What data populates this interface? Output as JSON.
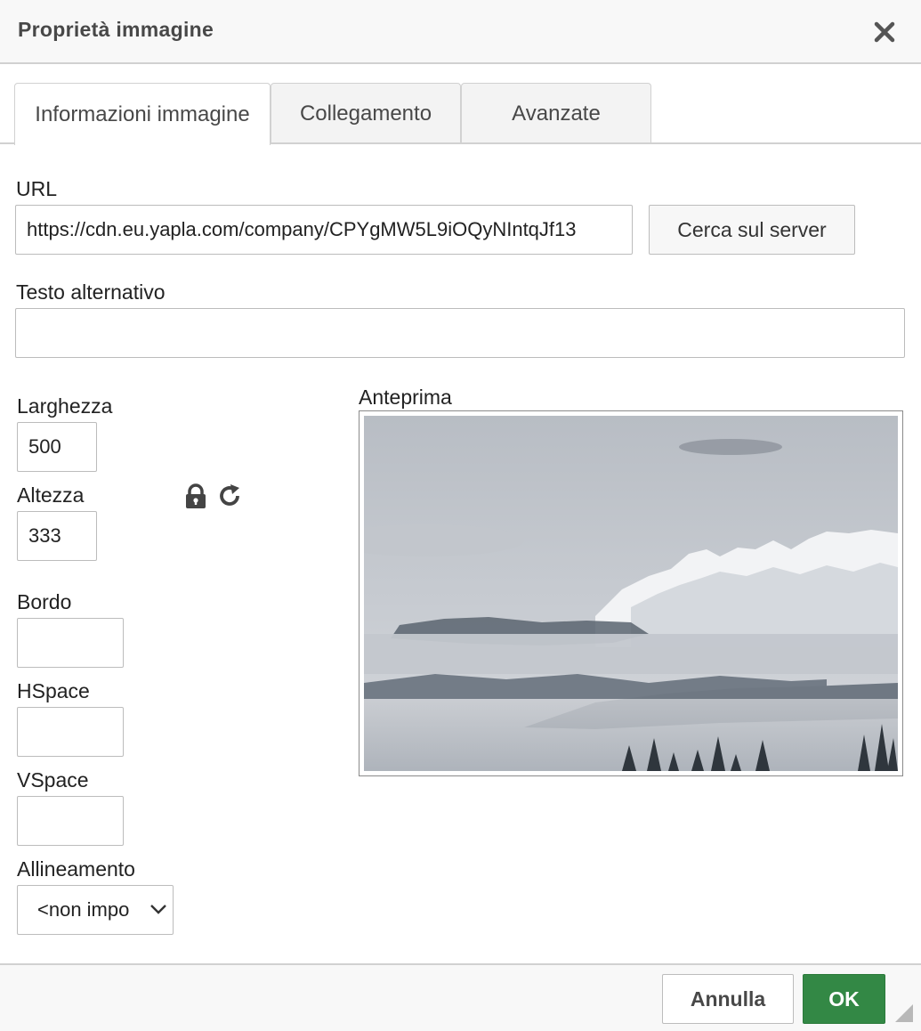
{
  "dialog": {
    "title": "Proprietà immagine"
  },
  "tabs": [
    {
      "label": "Informazioni immagine",
      "active": true
    },
    {
      "label": "Collegamento",
      "active": false
    },
    {
      "label": "Avanzate",
      "active": false
    }
  ],
  "url": {
    "label": "URL",
    "value": "https://cdn.eu.yapla.com/company/CPYgMW5L9iOQyNIntqJf13",
    "browse_label": "Cerca sul server"
  },
  "alt_text": {
    "label": "Testo alternativo",
    "value": ""
  },
  "width": {
    "label": "Larghezza",
    "value": "500"
  },
  "height": {
    "label": "Altezza",
    "value": "333"
  },
  "border": {
    "label": "Bordo",
    "value": ""
  },
  "hspace": {
    "label": "HSpace",
    "value": ""
  },
  "vspace": {
    "label": "VSpace",
    "value": ""
  },
  "align": {
    "label": "Allineamento",
    "value": "<non impo"
  },
  "preview": {
    "label": "Anteprima"
  },
  "footer": {
    "cancel_label": "Annulla",
    "ok_label": "OK"
  },
  "icons": {
    "close": "close-icon",
    "lock": "lock-icon",
    "reset": "reset-size-icon",
    "dropdown": "chevron-down-icon",
    "resize": "resize-handle-icon"
  },
  "colors": {
    "ok_button": "#338845",
    "header_bg": "#f8f8f8",
    "border": "#d1d1d1"
  }
}
